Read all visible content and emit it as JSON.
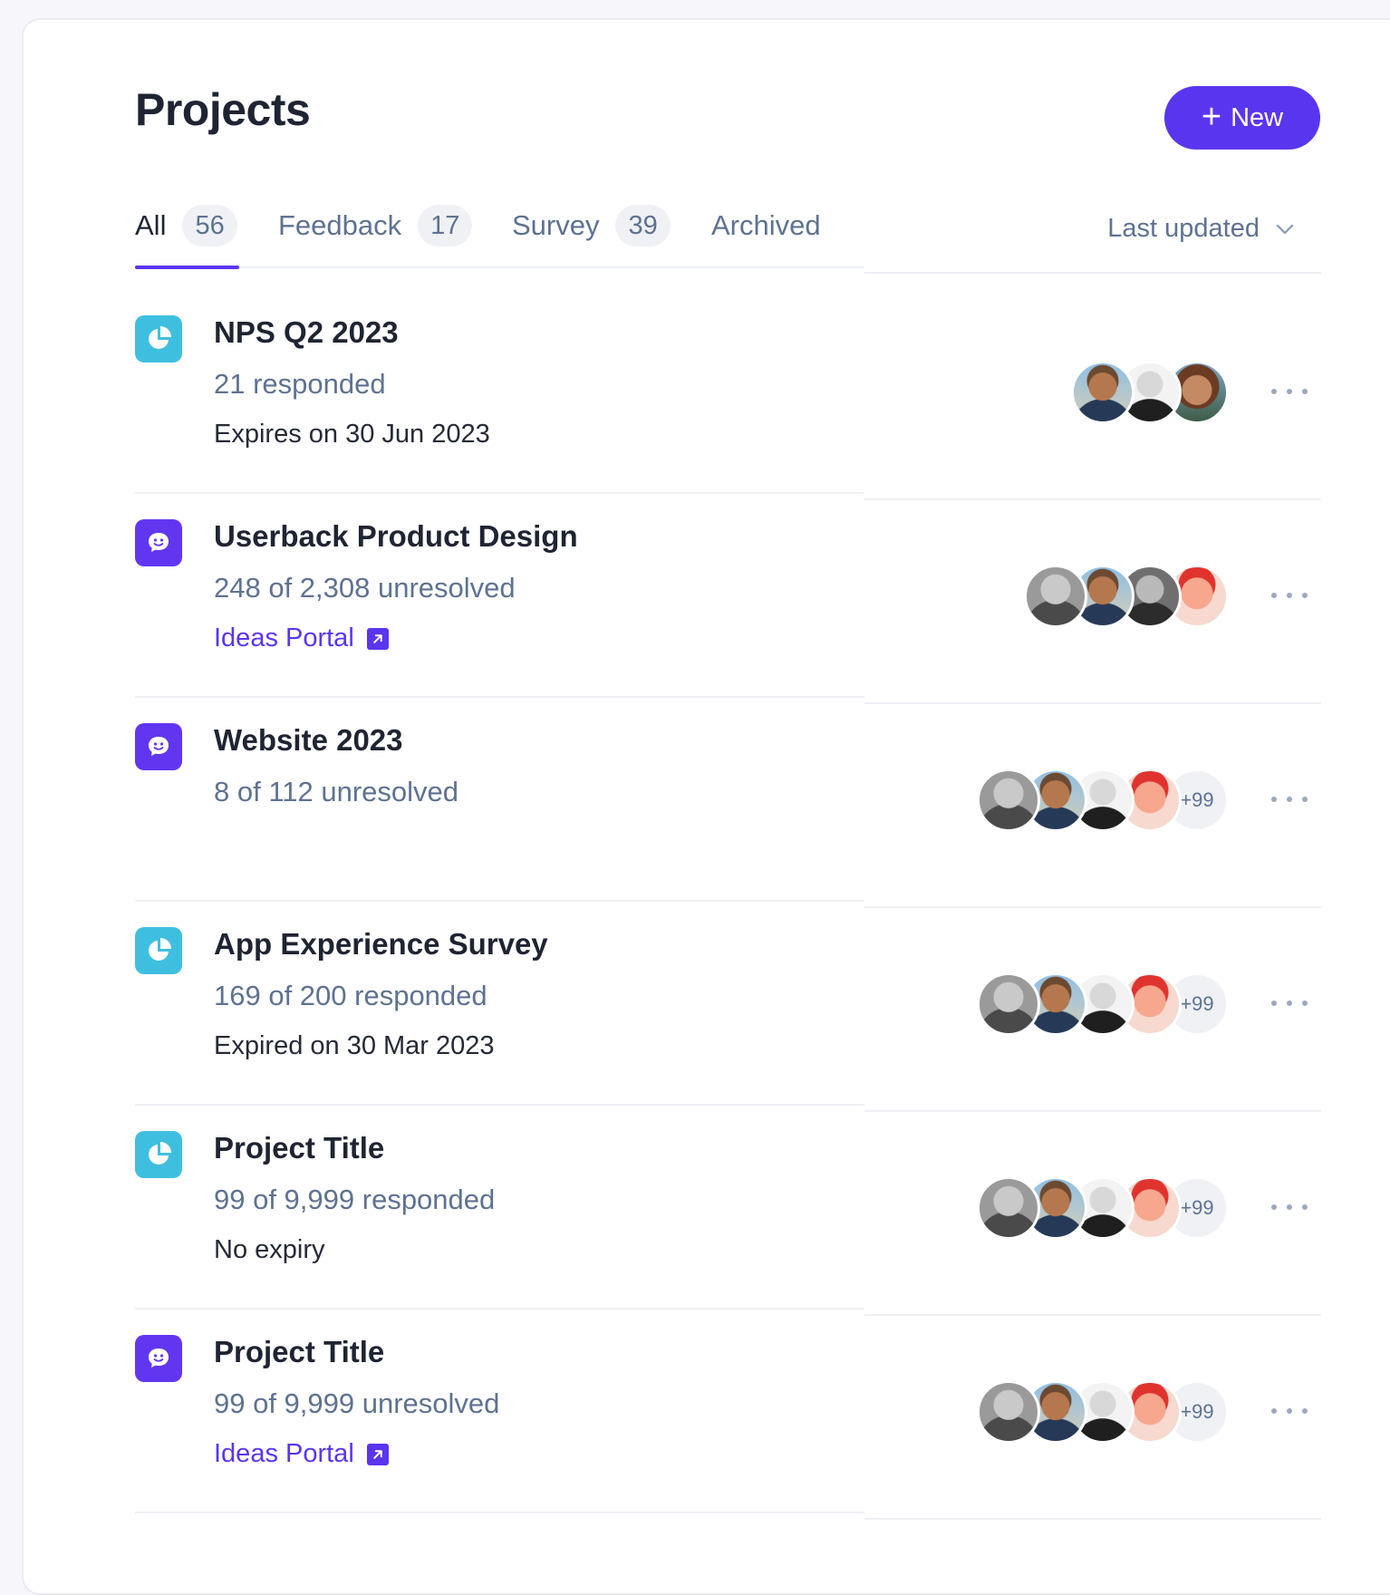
{
  "header": {
    "title": "Projects",
    "new_button": "New"
  },
  "tabs": [
    {
      "label": "All",
      "count": "56"
    },
    {
      "label": "Feedback",
      "count": "17"
    },
    {
      "label": "Survey",
      "count": "39"
    },
    {
      "label": "Archived"
    }
  ],
  "sort": {
    "label": "Last updated"
  },
  "colors": {
    "accent": "#5a35f0",
    "survey_icon": "#3fbfe0",
    "feedback_icon": "#6236f1",
    "muted_text": "#5e7291"
  },
  "projects": [
    {
      "type": "survey",
      "icon": "pie-chart-icon",
      "title": "NPS Q2 2023",
      "stat": "21 responded",
      "meta": "Expires on 30 Jun 2023"
    },
    {
      "type": "feedback",
      "icon": "chat-smile-icon",
      "title": "Userback Product Design",
      "stat": "248 of 2,308 unresolved",
      "link": "Ideas Portal"
    },
    {
      "type": "feedback",
      "icon": "chat-smile-icon",
      "title": "Website 2023",
      "stat": "8 of 112 unresolved",
      "more_count": "+99"
    },
    {
      "type": "survey",
      "icon": "pie-chart-icon",
      "title": "App Experience Survey",
      "stat": "169 of 200 responded",
      "meta": "Expired on 30 Mar 2023",
      "more_count": "+99"
    },
    {
      "type": "survey",
      "icon": "pie-chart-icon",
      "title": "Project Title",
      "stat": "99 of 9,999 responded",
      "meta": "No expiry",
      "more_count": "+99"
    },
    {
      "type": "feedback",
      "icon": "chat-smile-icon",
      "title": "Project Title",
      "stat": "99 of 9,999 unresolved",
      "link": "Ideas Portal",
      "more_count": "+99"
    }
  ]
}
